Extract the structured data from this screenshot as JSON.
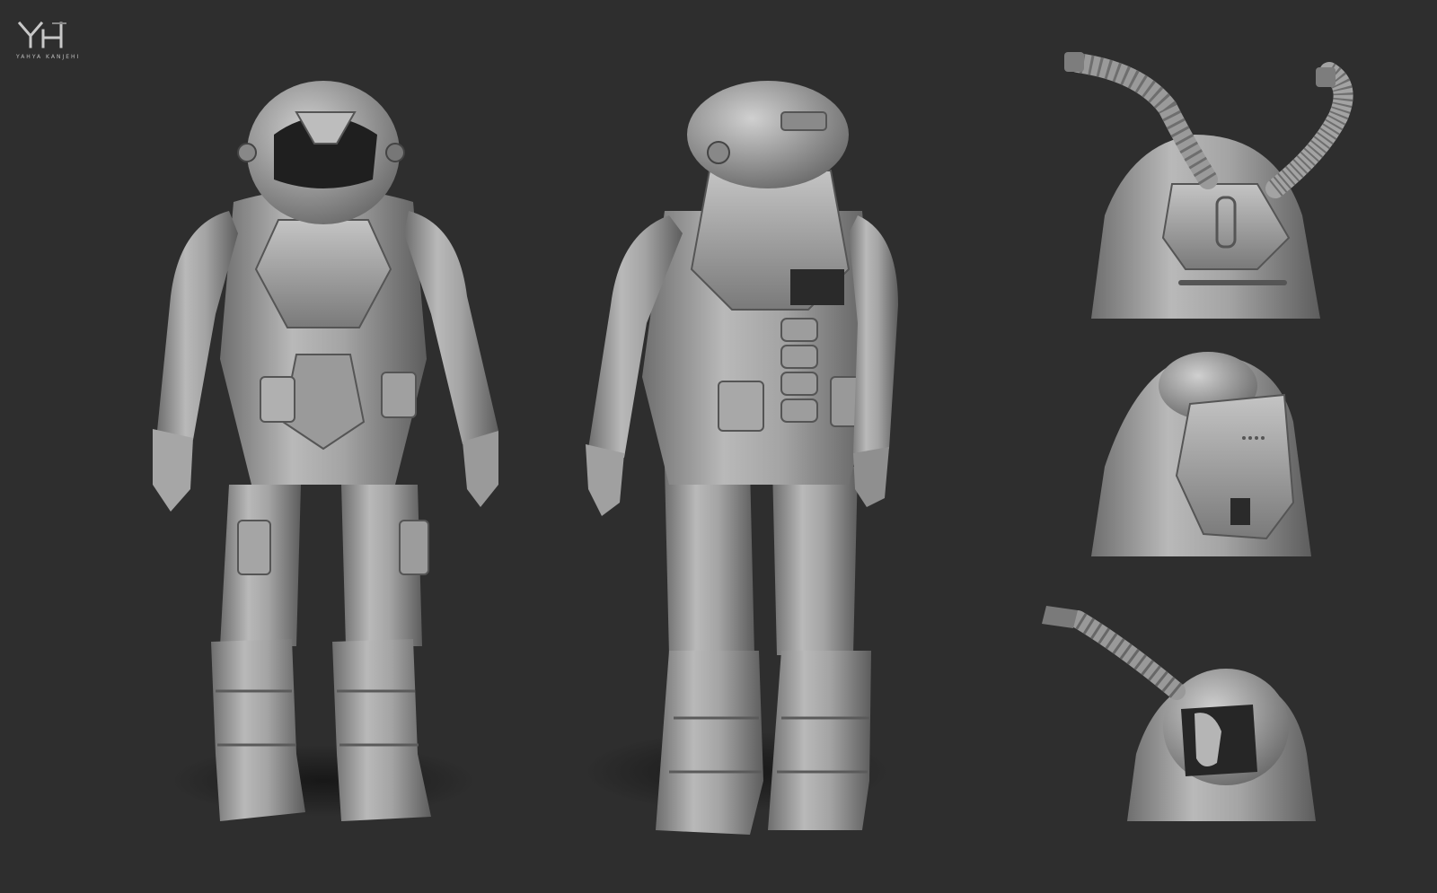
{
  "logo": {
    "caption": "YAHYA KANJEHI"
  },
  "colors": {
    "background": "#2e2e2e",
    "clay": "#a8a8a8",
    "clay_shadow": "#5c5c5c",
    "clay_highlight": "#d6d6d6"
  },
  "views": [
    {
      "name": "front-full-body"
    },
    {
      "name": "back-full-body"
    },
    {
      "name": "backpack-hoses-detail"
    },
    {
      "name": "backpack-side-detail"
    },
    {
      "name": "helmet-face-detail"
    }
  ]
}
